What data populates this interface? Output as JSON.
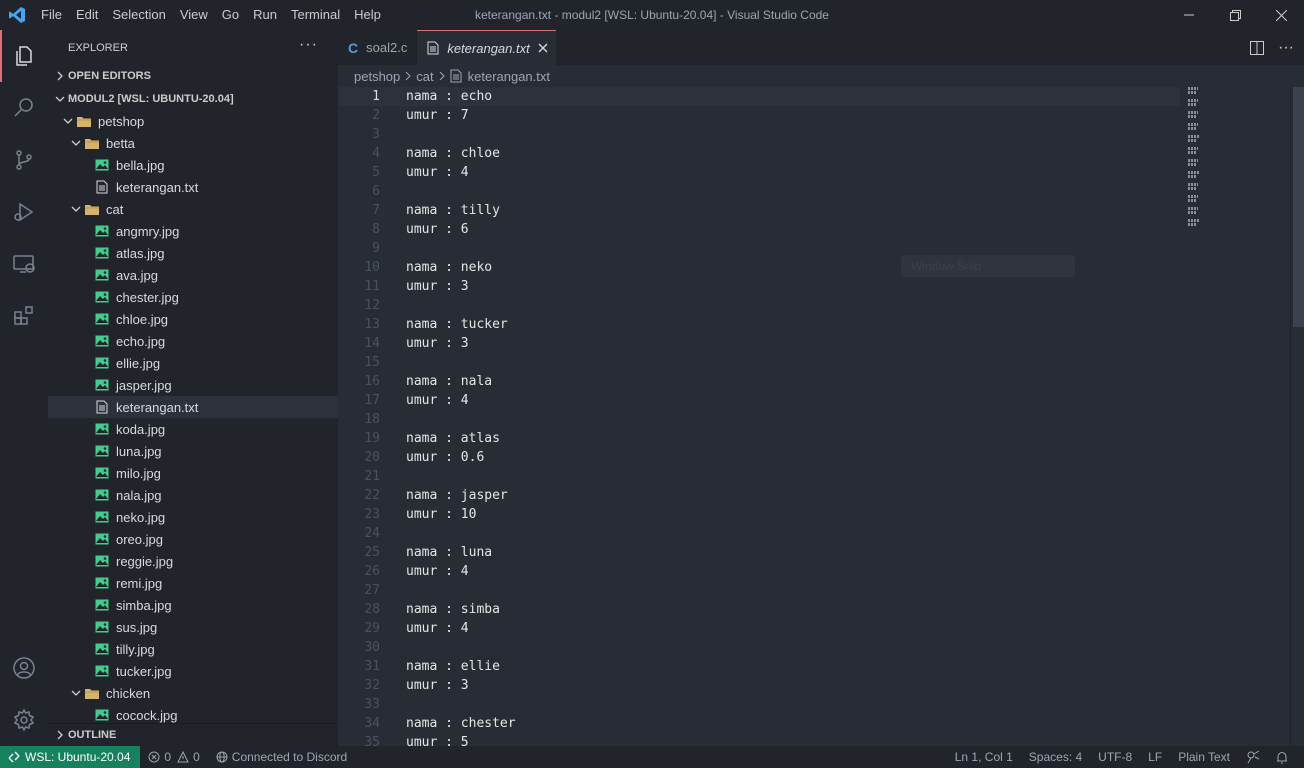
{
  "titlebar": {
    "menu": [
      "File",
      "Edit",
      "Selection",
      "View",
      "Go",
      "Run",
      "Terminal",
      "Help"
    ],
    "title": "keterangan.txt - modul2 [WSL: Ubuntu-20.04] - Visual Studio Code"
  },
  "colors": {
    "accent": "#e06c75",
    "remote_bg": "#16825d",
    "image_icon": "#3ecf8e",
    "folder_icon": "#d6b36b",
    "c_icon": "#4f9dde"
  },
  "activity_bar": {
    "icons": [
      "explorer-icon",
      "search-icon",
      "source-control-icon",
      "run-debug-icon",
      "remote-explorer-icon",
      "extensions-icon"
    ],
    "bottom_icons": [
      "account-icon",
      "manage-gear-icon"
    ]
  },
  "sidebar": {
    "title": "EXPLORER",
    "open_editors": "OPEN EDITORS",
    "workspace": "MODUL2 [WSL: UBUNTU-20.04]",
    "outline": "OUTLINE",
    "tree": [
      {
        "label": "petshop",
        "type": "folder",
        "depth": 0
      },
      {
        "label": "betta",
        "type": "folder",
        "depth": 1
      },
      {
        "label": "bella.jpg",
        "type": "image",
        "depth": 2
      },
      {
        "label": "keterangan.txt",
        "type": "text",
        "depth": 2
      },
      {
        "label": "cat",
        "type": "folder",
        "depth": 1
      },
      {
        "label": "angmry.jpg",
        "type": "image",
        "depth": 2
      },
      {
        "label": "atlas.jpg",
        "type": "image",
        "depth": 2
      },
      {
        "label": "ava.jpg",
        "type": "image",
        "depth": 2
      },
      {
        "label": "chester.jpg",
        "type": "image",
        "depth": 2
      },
      {
        "label": "chloe.jpg",
        "type": "image",
        "depth": 2
      },
      {
        "label": "echo.jpg",
        "type": "image",
        "depth": 2
      },
      {
        "label": "ellie.jpg",
        "type": "image",
        "depth": 2
      },
      {
        "label": "jasper.jpg",
        "type": "image",
        "depth": 2
      },
      {
        "label": "keterangan.txt",
        "type": "text",
        "depth": 2,
        "selected": true
      },
      {
        "label": "koda.jpg",
        "type": "image",
        "depth": 2
      },
      {
        "label": "luna.jpg",
        "type": "image",
        "depth": 2
      },
      {
        "label": "milo.jpg",
        "type": "image",
        "depth": 2
      },
      {
        "label": "nala.jpg",
        "type": "image",
        "depth": 2
      },
      {
        "label": "neko.jpg",
        "type": "image",
        "depth": 2
      },
      {
        "label": "oreo.jpg",
        "type": "image",
        "depth": 2
      },
      {
        "label": "reggie.jpg",
        "type": "image",
        "depth": 2
      },
      {
        "label": "remi.jpg",
        "type": "image",
        "depth": 2
      },
      {
        "label": "simba.jpg",
        "type": "image",
        "depth": 2
      },
      {
        "label": "sus.jpg",
        "type": "image",
        "depth": 2
      },
      {
        "label": "tilly.jpg",
        "type": "image",
        "depth": 2
      },
      {
        "label": "tucker.jpg",
        "type": "image",
        "depth": 2
      },
      {
        "label": "chicken",
        "type": "folder",
        "depth": 1
      },
      {
        "label": "cocock.jpg",
        "type": "image",
        "depth": 2
      }
    ]
  },
  "tabs": [
    {
      "label": "soal2.c",
      "icon": "C",
      "active": false
    },
    {
      "label": "keterangan.txt",
      "active": true
    }
  ],
  "breadcrumb": [
    "petshop",
    "cat",
    "keterangan.txt"
  ],
  "editor": {
    "current_line": 1,
    "lines": [
      "nama : echo",
      "umur : 7",
      "",
      "nama : chloe",
      "umur : 4",
      "",
      "nama : tilly",
      "umur : 6",
      "",
      "nama : neko",
      "umur : 3",
      "",
      "nama : tucker",
      "umur : 3",
      "",
      "nama : nala",
      "umur : 4",
      "",
      "nama : atlas",
      "umur : 0.6",
      "",
      "nama : jasper",
      "umur : 10",
      "",
      "nama : luna",
      "umur : 4",
      "",
      "nama : simba",
      "umur : 4",
      "",
      "nama : ellie",
      "umur : 3",
      "",
      "nama : chester",
      "umur : 5"
    ],
    "hover_ghost": "Window Snip"
  },
  "statusbar": {
    "remote": "WSL: Ubuntu-20.04",
    "errors": "0",
    "warnings": "0",
    "discord": "Connected to Discord",
    "cursor": "Ln 1, Col 1",
    "spaces": "Spaces: 4",
    "encoding": "UTF-8",
    "eol": "LF",
    "language": "Plain Text"
  }
}
